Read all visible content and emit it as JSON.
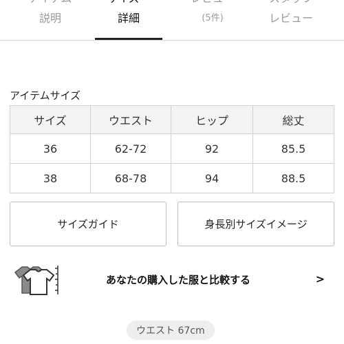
{
  "tabs": [
    {
      "line1": "アイテム",
      "line2": "説明"
    },
    {
      "line1": "サイズ・",
      "line2": "詳細"
    },
    {
      "line1": "レビュー",
      "line2": "(5件)"
    },
    {
      "line1": "スタッフ",
      "line2": "レビュー"
    }
  ],
  "size_section": {
    "title": "アイテムサイズ",
    "headers": [
      "サイズ",
      "ウエスト",
      "ヒップ",
      "総丈"
    ],
    "rows": [
      [
        "36",
        "62-72",
        "92",
        "85.5"
      ],
      [
        "38",
        "68-78",
        "94",
        "88.5"
      ]
    ]
  },
  "buttons": {
    "size_guide": "サイズガイド",
    "size_image": "身長別サイズイメージ"
  },
  "compare": {
    "text": "あなたの購入した服と比較する",
    "chevron": ">"
  },
  "chip": {
    "label": "ウエスト 67cm"
  },
  "colors": {
    "active_text": "#111111",
    "dim_text": "#9a9a9a",
    "header_bg": "#f3f3f3",
    "chip_bg": "#eeeeee"
  }
}
